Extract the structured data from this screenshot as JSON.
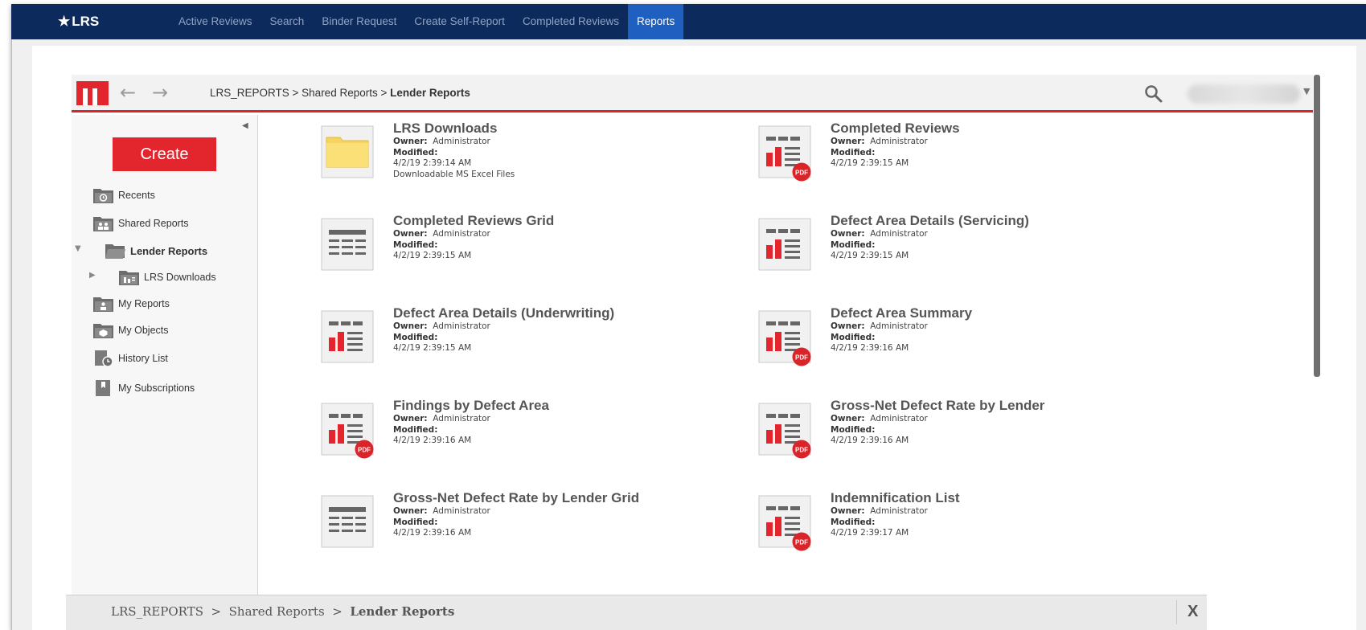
{
  "nav": {
    "brand": "LRS",
    "items": [
      {
        "label": "Active Reviews",
        "active": false
      },
      {
        "label": "Search",
        "active": false
      },
      {
        "label": "Binder Request",
        "active": false
      },
      {
        "label": "Create Self-Report",
        "active": false
      },
      {
        "label": "Completed Reviews",
        "active": false
      },
      {
        "label": "Reports",
        "active": true
      }
    ]
  },
  "toolbar": {
    "breadcrumb_path": "LRS_REPORTS > Shared Reports > ",
    "breadcrumb_current": "Lender Reports"
  },
  "sidebar": {
    "create_label": "Create",
    "items": [
      {
        "label": "Recents",
        "icon": "recents-folder-icon"
      },
      {
        "label": "Shared Reports",
        "icon": "shared-folder-icon"
      },
      {
        "label": "Lender Reports",
        "icon": "open-folder-icon"
      },
      {
        "label": "LRS Downloads",
        "icon": "downloads-folder-icon"
      },
      {
        "label": "My Reports",
        "icon": "my-reports-folder-icon"
      },
      {
        "label": "My Objects",
        "icon": "my-objects-folder-icon"
      },
      {
        "label": "History List",
        "icon": "history-list-icon"
      },
      {
        "label": "My Subscriptions",
        "icon": "subscriptions-icon"
      }
    ]
  },
  "labels": {
    "owner": "Owner:",
    "modified": "Modified:"
  },
  "reports": [
    {
      "name": "LRS Downloads",
      "owner": "Administrator",
      "modified": "4/2/19 2:39:14 AM",
      "description": "Downloadable MS Excel Files",
      "icon": "folder-icon",
      "pdf": false
    },
    {
      "name": "Completed Reviews",
      "owner": "Administrator",
      "modified": "4/2/19 2:39:15 AM",
      "description": "",
      "icon": "report-icon",
      "pdf": true
    },
    {
      "name": "Completed Reviews Grid",
      "owner": "Administrator",
      "modified": "4/2/19 2:39:15 AM",
      "description": "",
      "icon": "grid-report-icon",
      "pdf": false
    },
    {
      "name": "Defect Area Details (Servicing)",
      "owner": "Administrator",
      "modified": "4/2/19 2:39:15 AM",
      "description": "",
      "icon": "report-icon",
      "pdf": false
    },
    {
      "name": "Defect Area Details (Underwriting)",
      "owner": "Administrator",
      "modified": "4/2/19 2:39:15 AM",
      "description": "",
      "icon": "report-icon",
      "pdf": false
    },
    {
      "name": "Defect Area Summary",
      "owner": "Administrator",
      "modified": "4/2/19 2:39:16 AM",
      "description": "",
      "icon": "report-icon",
      "pdf": true
    },
    {
      "name": "Findings by Defect Area",
      "owner": "Administrator",
      "modified": "4/2/19 2:39:16 AM",
      "description": "",
      "icon": "report-icon",
      "pdf": true
    },
    {
      "name": "Gross-Net Defect Rate by Lender",
      "owner": "Administrator",
      "modified": "4/2/19 2:39:16 AM",
      "description": "",
      "icon": "report-icon",
      "pdf": true
    },
    {
      "name": "Gross-Net Defect Rate by Lender Grid",
      "owner": "Administrator",
      "modified": "4/2/19 2:39:16 AM",
      "description": "",
      "icon": "grid-report-icon",
      "pdf": false
    },
    {
      "name": "Indemnification List",
      "owner": "Administrator",
      "modified": "4/2/19 2:39:17 AM",
      "description": "",
      "icon": "report-icon",
      "pdf": true
    }
  ],
  "pdf_badge": "PDF",
  "bottom": {
    "crumb1": "LRS_REPORTS",
    "crumb2": "Shared Reports",
    "crumb3": "Lender Reports",
    "separator": ">",
    "close": "X"
  }
}
